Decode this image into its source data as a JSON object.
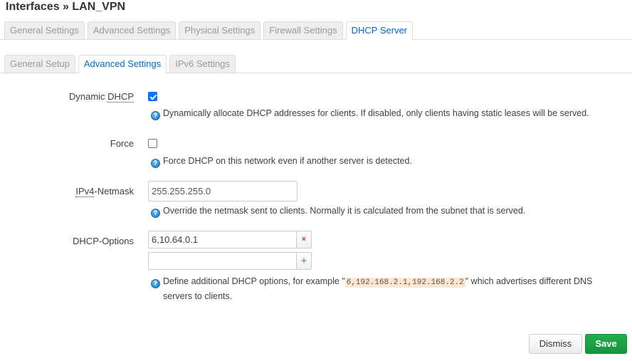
{
  "page": {
    "title": "Interfaces » LAN_VPN"
  },
  "main_tabs": [
    {
      "label": "General Settings",
      "active": false
    },
    {
      "label": "Advanced Settings",
      "active": false
    },
    {
      "label": "Physical Settings",
      "active": false
    },
    {
      "label": "Firewall Settings",
      "active": false
    },
    {
      "label": "DHCP Server",
      "active": true
    }
  ],
  "sub_tabs": [
    {
      "label": "General Setup",
      "active": false
    },
    {
      "label": "Advanced Settings",
      "active": true
    },
    {
      "label": "IPv6 Settings",
      "active": false
    }
  ],
  "form": {
    "dynamic_dhcp": {
      "label_prefix": "Dynamic ",
      "label_abbr": "DHCP",
      "checked": true,
      "help": "Dynamically allocate DHCP addresses for clients. If disabled, only clients having static leases will be served."
    },
    "force": {
      "label": "Force",
      "checked": false,
      "help": "Force DHCP on this network even if another server is detected."
    },
    "netmask": {
      "label_abbr": "IPv4",
      "label_suffix": "-Netmask",
      "value": "255.255.255.0",
      "help": "Override the netmask sent to clients. Normally it is calculated from the subnet that is served."
    },
    "dhcp_options": {
      "label": "DHCP-Options",
      "values": [
        "6,10.64.0.1",
        ""
      ],
      "remove_symbol": "×",
      "add_symbol": "+",
      "help_before": "Define additional DHCP options, for example \"",
      "help_example": "6,192.168.2.1,192.168.2.2",
      "help_after": "\" which advertises different DNS",
      "help_line2": "servers to clients."
    }
  },
  "icons": {
    "help": "?"
  },
  "actions": {
    "dismiss": "Dismiss",
    "save": "Save"
  },
  "colors": {
    "active_tab": "#0069d6",
    "save_button": "#1a9f45",
    "checkbox_checked": "#0075ff",
    "remove_icon": "#e03030",
    "add_icon": "#19a84a",
    "code_background": "#fde6cf"
  }
}
